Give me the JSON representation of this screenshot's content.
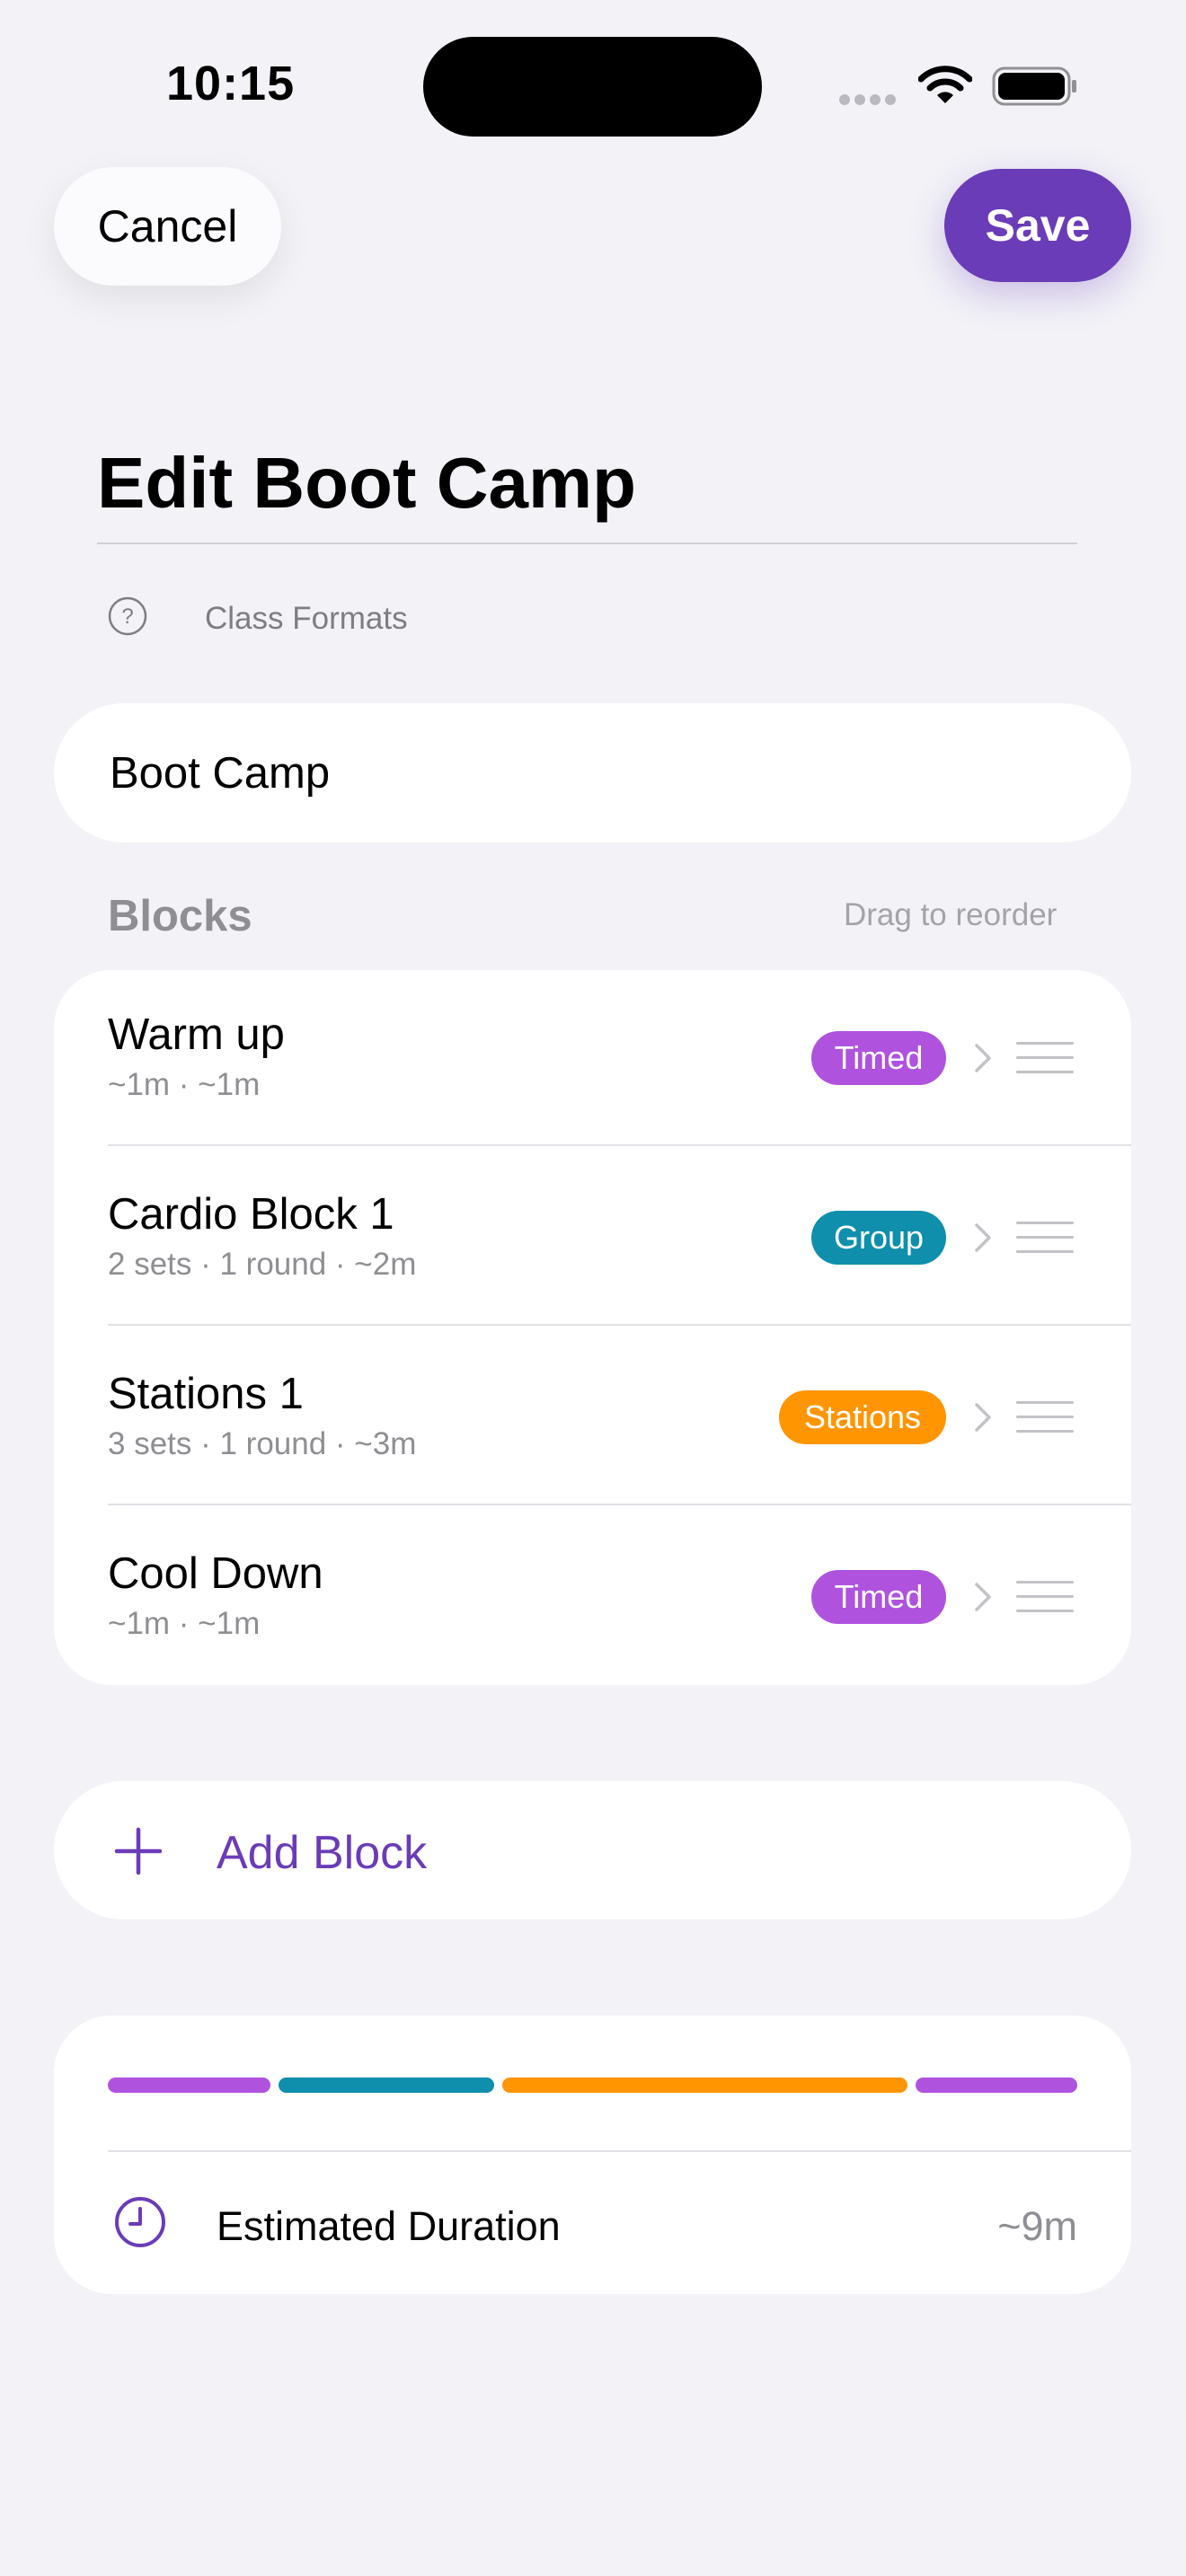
{
  "status_bar": {
    "time": "10:15"
  },
  "header": {
    "cancel_label": "Cancel",
    "save_label": "Save"
  },
  "page": {
    "title": "Edit Boot Camp",
    "breadcrumb": "Class Formats",
    "help_icon": "question-circle-icon"
  },
  "name_field": {
    "value": "Boot Camp"
  },
  "blocks_section": {
    "title": "Blocks",
    "hint": "Drag to reorder"
  },
  "blocks": [
    {
      "name": "Warm up",
      "meta": "~1m · ~1m",
      "badge": "Timed",
      "badge_color": "#af52de"
    },
    {
      "name": "Cardio Block 1",
      "meta": "2 sets · 1 round · ~2m",
      "badge": "Group",
      "badge_color": "#0f8fac"
    },
    {
      "name": "Stations 1",
      "meta": "3 sets · 1 round · ~3m",
      "badge": "Stations",
      "badge_color": "#ff9500"
    },
    {
      "name": "Cool Down",
      "meta": "~1m · ~1m",
      "badge": "Timed",
      "badge_color": "#af52de"
    }
  ],
  "add_block": {
    "label": "Add Block",
    "icon": "plus-icon"
  },
  "duration": {
    "label": "Estimated Duration",
    "value": "~9m",
    "icon": "clock-icon",
    "segments": [
      {
        "block": "Warm up",
        "color": "#af52de"
      },
      {
        "block": "Cardio Block 1",
        "color": "#0f8fac"
      },
      {
        "block": "Stations 1",
        "color": "#ff9500"
      },
      {
        "block": "Cool Down",
        "color": "#af52de"
      }
    ]
  },
  "colors": {
    "accent": "#6a3cb8",
    "background": "#f2f2f7"
  }
}
